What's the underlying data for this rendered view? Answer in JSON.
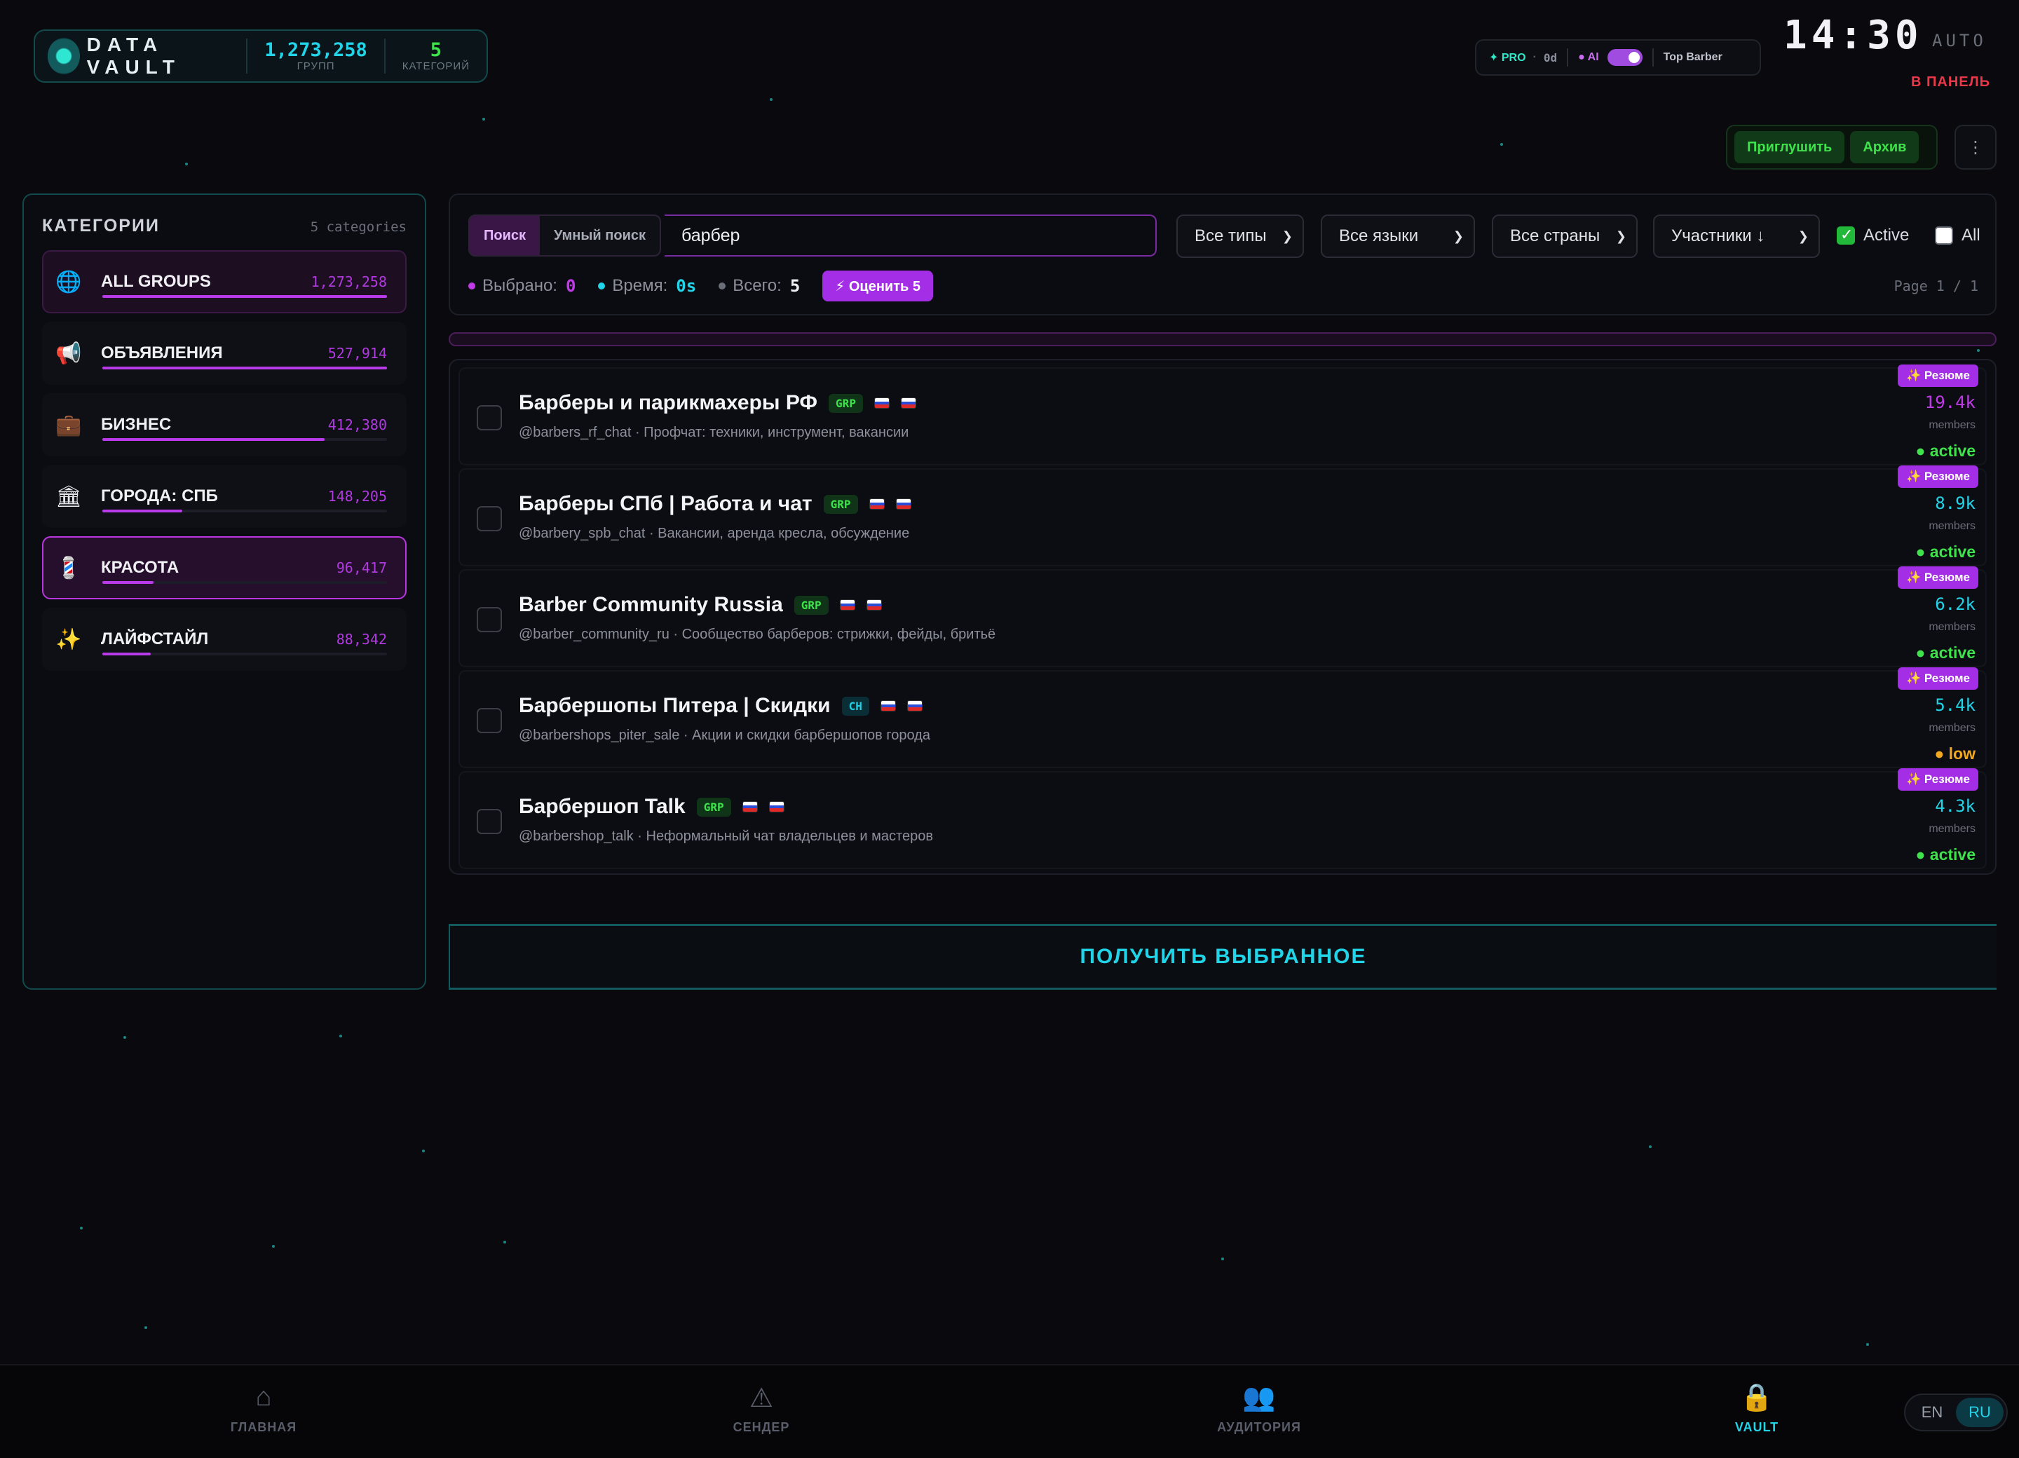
{
  "brand": {
    "title": "DATA VAULT",
    "groups_value": "1,273,258",
    "groups_label": "ГРУПП",
    "categories_value": "5",
    "categories_label": "КАТЕГОРИЙ"
  },
  "status": {
    "pro": "✦ PRO",
    "days": "0d",
    "ai": "● AI",
    "ai_enabled": true,
    "user": "Top Barber"
  },
  "clock": {
    "time": "14:30",
    "mode": "AUTO",
    "panel_link": "В ПАНЕЛЬ"
  },
  "actions": {
    "invite": "Приглушить",
    "archive": "Архив",
    "more_icon": "⋮"
  },
  "sidebar": {
    "title": "КАТЕГОРИИ",
    "count": "5 categories",
    "items": [
      {
        "icon": "🌐",
        "label": "ALL GROUPS",
        "count": "1,273,258",
        "fill": 1.0
      },
      {
        "icon": "📢",
        "label": "ОБЪЯВЛЕНИЯ",
        "count": "527,914",
        "fill": 1.0
      },
      {
        "icon": "💼",
        "label": "БИЗНЕС",
        "count": "412,380",
        "fill": 0.78
      },
      {
        "icon": "🏛",
        "label": "ГОРОДА: СПБ",
        "count": "148,205",
        "fill": 0.28
      },
      {
        "icon": "💈",
        "label": "КРАСОТА",
        "count": "96,417",
        "fill": 0.18
      },
      {
        "icon": "✨",
        "label": "ЛАЙФСТАЙЛ",
        "count": "88,342",
        "fill": 0.17
      }
    ]
  },
  "filters": {
    "tab_search": "Поиск",
    "tab_smart": "Умный поиск",
    "query": "барбер",
    "type": "Все типы",
    "language": "Все языки",
    "country": "Все страны",
    "sort": "Участники ↓",
    "active_label": "Active",
    "active_checked": true,
    "all_label": "All",
    "all_checked": false
  },
  "stats": {
    "selected_label": "Выбрано:",
    "selected": "0",
    "time_label": "Время:",
    "time": "0s",
    "total_label": "Всего:",
    "total": "5",
    "rate_button": "⚡ Оценить 5",
    "page": "Page 1 / 1"
  },
  "results": [
    {
      "name": "Барберы и парикмахеры РФ",
      "tag": "GRP",
      "desc": "@barbers_rf_chat · Профчат: техники, инструмент, вакансии",
      "resume": "✨ Резюме",
      "members": "19.4k",
      "members_label": "members",
      "status": "● active",
      "status_kind": "act",
      "members_color": "#c03ae8"
    },
    {
      "name": "Барберы СПб | Работа и чат",
      "tag": "GRP",
      "desc": "@barbery_spb_chat · Вакансии, аренда кресла, обсуждение",
      "resume": "✨ Резюме",
      "members": "8.9k",
      "members_label": "members",
      "status": "● active",
      "status_kind": "act",
      "members_color": "#21d4e8"
    },
    {
      "name": "Barber Community Russia",
      "tag": "GRP",
      "desc": "@barber_community_ru · Сообщество барберов: стрижки, фейды, бритьё",
      "resume": "✨ Резюме",
      "members": "6.2k",
      "members_label": "members",
      "status": "● active",
      "status_kind": "act",
      "members_color": "#21d4e8"
    },
    {
      "name": "Барбершопы Питера | Скидки",
      "tag": "CH",
      "desc": "@barbershops_piter_sale · Акции и скидки барбершопов города",
      "resume": "✨ Резюме",
      "members": "5.4k",
      "members_label": "members",
      "status": "● low",
      "status_kind": "low",
      "members_color": "#21d4e8"
    },
    {
      "name": "Барбершоп Talk",
      "tag": "GRP",
      "desc": "@barbershop_talk · Неформальный чат владельцев и мастеров",
      "resume": "✨ Резюме",
      "members": "4.3k",
      "members_label": "members",
      "status": "● active",
      "status_kind": "act",
      "members_color": "#21d4e8"
    }
  ],
  "get_selected": "ПОЛУЧИТЬ ВЫБРАННОЕ",
  "nav": [
    {
      "icon": "⌂",
      "label": "ГЛАВНАЯ",
      "active": false
    },
    {
      "icon": "⚠",
      "label": "СЕНДЕР",
      "active": false
    },
    {
      "icon": "👥",
      "label": "АУДИТОРИЯ",
      "active": false
    },
    {
      "icon": "🔒",
      "label": "VAULT",
      "active": true
    }
  ],
  "lang": {
    "en": "EN",
    "ru": "RU",
    "active": "RU"
  },
  "colors": {
    "accent_purple": "#b83ae8",
    "accent_cyan": "#21d4e8",
    "accent_green": "#3ee24a",
    "warning": "#f0a820",
    "danger": "#e8384a"
  }
}
